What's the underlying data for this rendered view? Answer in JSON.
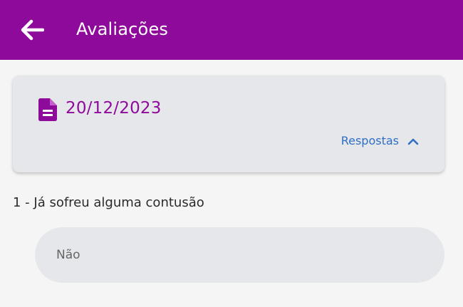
{
  "colors": {
    "brand": "#8e0a9a",
    "link": "#2f6fc4",
    "card_bg": "#e6e7eb",
    "page_bg": "#f5f5f5"
  },
  "app_bar": {
    "back_icon": "arrow-left-icon",
    "title": "Avaliações"
  },
  "evaluation_card": {
    "icon": "document-icon",
    "date": "20/12/2023",
    "answers_label": "Respostas",
    "answers_icon": "chevron-up-icon"
  },
  "questions": [
    {
      "text": "1 - Já sofreu alguma contusão",
      "answer": "Não"
    }
  ]
}
